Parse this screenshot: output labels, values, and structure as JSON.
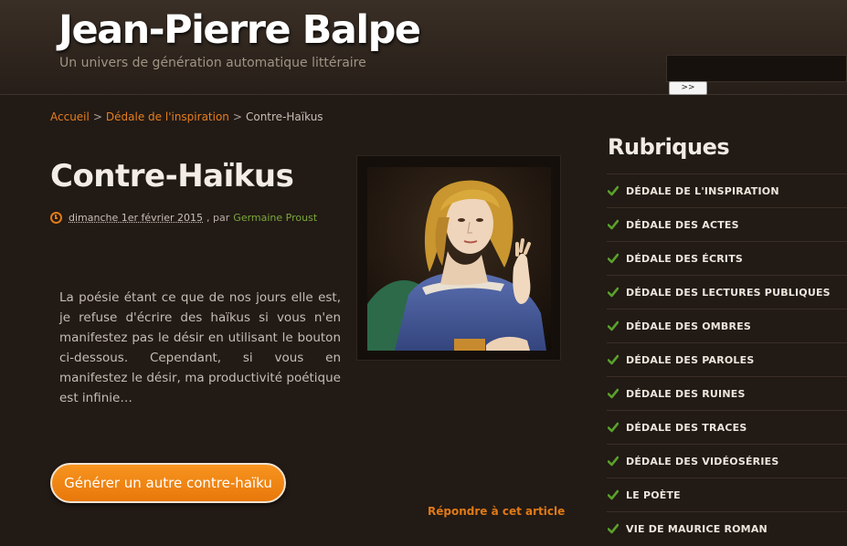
{
  "header": {
    "site_title": "Jean-Pierre Balpe",
    "tagline": "Un univers de génération automatique littéraire",
    "search_button": ">>"
  },
  "breadcrumb": {
    "home": "Accueil",
    "separator": ">",
    "section": "Dédale de l'inspiration",
    "current": "Contre-Haïkus"
  },
  "article": {
    "title": "Contre-Haïkus",
    "date": "dimanche 1er février 2015",
    "by": ", par",
    "author": "Germaine Proust",
    "text": "La poésie étant ce que de nos jours elle est, je refuse d'écrire des haïkus si vous n'en manifestez pas le désir en utilisant le bouton ci-dessous. Cependant, si vous en manifestez le désir, ma productivité poétique est infinie…",
    "generate_button": "Générer un autre contre-haïku",
    "reply_link": "Répondre à cet article"
  },
  "sidebar": {
    "title": "Rubriques",
    "items": [
      "DÉDALE DE L'INSPIRATION",
      "DÉDALE DES ACTES",
      "DÉDALE DES ÉCRITS",
      "DÉDALE DES LECTURES PUBLIQUES",
      "DÉDALE DES OMBRES",
      "DÉDALE DES PAROLES",
      "DÉDALE DES RUINES",
      "DÉDALE DES TRACES",
      "DÉDALE DES VIDÉOSÉRIES",
      "LE POÈTE",
      "VIE DE MAURICE ROMAN"
    ]
  },
  "colors": {
    "accent": "#e57e1f",
    "author": "#7aa83a",
    "check": "#5aa02c",
    "background": "#221a15"
  }
}
